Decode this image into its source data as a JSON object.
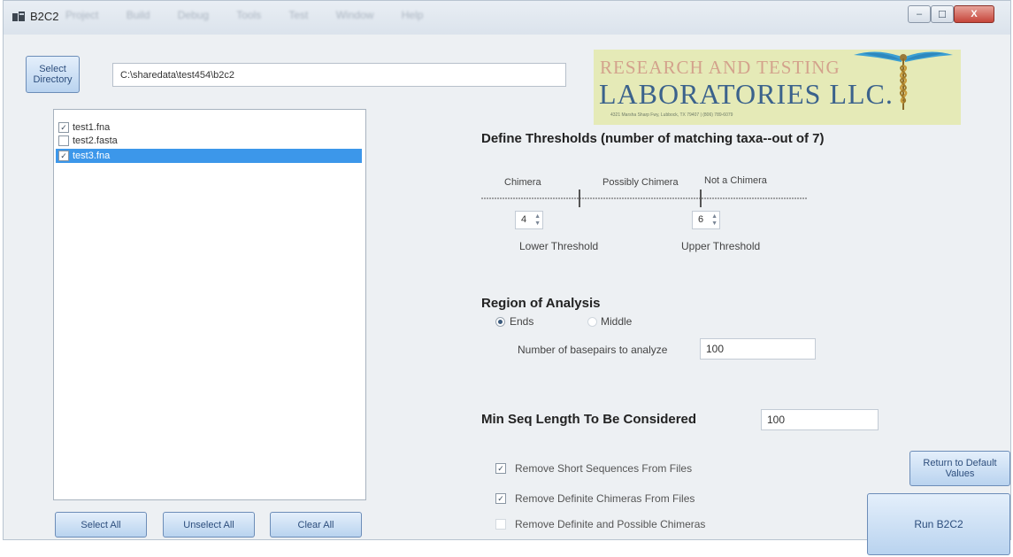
{
  "window": {
    "title": "B2C2",
    "menu": [
      "Project",
      "Build",
      "Debug",
      "Tools",
      "Test",
      "Window",
      "Help"
    ],
    "caption_buttons": {
      "minimize": "–",
      "maximize": "☐",
      "close": "X"
    }
  },
  "directory": {
    "select_label": "Select Directory",
    "path": "C:\\sharedata\\test454\\b2c2"
  },
  "files": [
    {
      "name": "test1.fna",
      "checked": true,
      "selected": false
    },
    {
      "name": "test2.fasta",
      "checked": false,
      "selected": false
    },
    {
      "name": "test3.fna",
      "checked": true,
      "selected": true
    }
  ],
  "list_buttons": {
    "select_all": "Select All",
    "unselect_all": "Unselect All",
    "clear_all": "Clear All"
  },
  "logo": {
    "line1": "RESEARCH AND TESTING",
    "line2": "LABORATORIES LLC.",
    "line3": "4321 Marsha Sharp Fwy, Lubbock, TX 79407 | (806) 789-6079",
    "colors": {
      "background": "#e5eab7",
      "line1": "#d3a28c",
      "line2": "#3b628c",
      "emblem": "#3a9fd3"
    }
  },
  "thresholds": {
    "heading": "Define Thresholds (number of matching taxa--out of 7)",
    "zones": [
      "Chimera",
      "Possibly Chimera",
      "Not a Chimera"
    ],
    "lower": {
      "value": "4",
      "label": "Lower Threshold"
    },
    "upper": {
      "value": "6",
      "label": "Upper Threshold"
    }
  },
  "region": {
    "heading": "Region of Analysis",
    "options": [
      "Ends",
      "Middle"
    ],
    "selected": "Ends",
    "basepairs_label": "Number of basepairs to analyze",
    "basepairs_value": "100"
  },
  "min_seq": {
    "heading": "Min Seq Length To Be Considered",
    "value": "100"
  },
  "options": [
    {
      "label": "Remove Short Sequences From Files",
      "checked": true
    },
    {
      "label": "Remove Definite Chimeras From Files",
      "checked": true
    },
    {
      "label": "Remove Definite and Possible Chimeras",
      "checked": false
    }
  ],
  "action_buttons": {
    "return_defaults": "Return to Default Values",
    "run": "Run B2C2"
  },
  "colors": {
    "selection": "#3c97ea",
    "button_text": "#2d4e7d",
    "window_bg": "#edf0f3"
  }
}
